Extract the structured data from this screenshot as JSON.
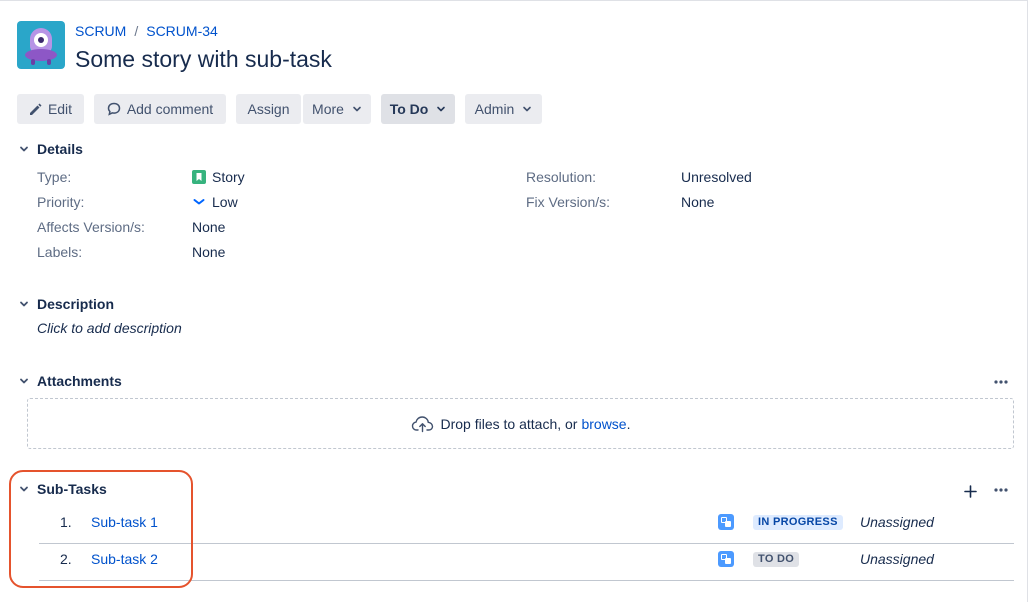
{
  "breadcrumb": {
    "project": "SCRUM",
    "separator": "/",
    "issue_key": "SCRUM-34"
  },
  "issue": {
    "title": "Some story with sub-task"
  },
  "toolbar": {
    "edit": "Edit",
    "add_comment": "Add comment",
    "assign": "Assign",
    "more": "More",
    "status": "To Do",
    "admin": "Admin"
  },
  "details": {
    "heading": "Details",
    "type_label": "Type:",
    "type_value": "Story",
    "priority_label": "Priority:",
    "priority_value": "Low",
    "affects_label": "Affects Version/s:",
    "affects_value": "None",
    "labels_label": "Labels:",
    "labels_value": "None",
    "resolution_label": "Resolution:",
    "resolution_value": "Unresolved",
    "fix_label": "Fix Version/s:",
    "fix_value": "None"
  },
  "description": {
    "heading": "Description",
    "placeholder": "Click to add description"
  },
  "attachments": {
    "heading": "Attachments",
    "drop_text": "Drop files to attach, or",
    "browse": "browse",
    "suffix": "."
  },
  "subtasks": {
    "heading": "Sub-Tasks",
    "items": [
      {
        "num": "1.",
        "summary": "Sub-task 1",
        "status": "IN PROGRESS",
        "assignee": "Unassigned"
      },
      {
        "num": "2.",
        "summary": "Sub-task 2",
        "status": "TO DO",
        "assignee": "Unassigned"
      }
    ]
  },
  "colors": {
    "link": "#0052cc",
    "highlight": "#e5532d",
    "story_icon": "#36b37e",
    "subtask_icon": "#4c9aff"
  },
  "icons": {
    "project_avatar": "ufo-avatar-icon",
    "edit": "pencil-icon",
    "comment": "comment-bubble-icon",
    "chevron": "chevron-down-icon",
    "story": "bookmark-story-icon",
    "priority": "chevron-down-low-icon",
    "upload": "cloud-upload-icon",
    "more": "ellipsis-icon",
    "add": "plus-icon",
    "subtask": "subtask-icon"
  }
}
